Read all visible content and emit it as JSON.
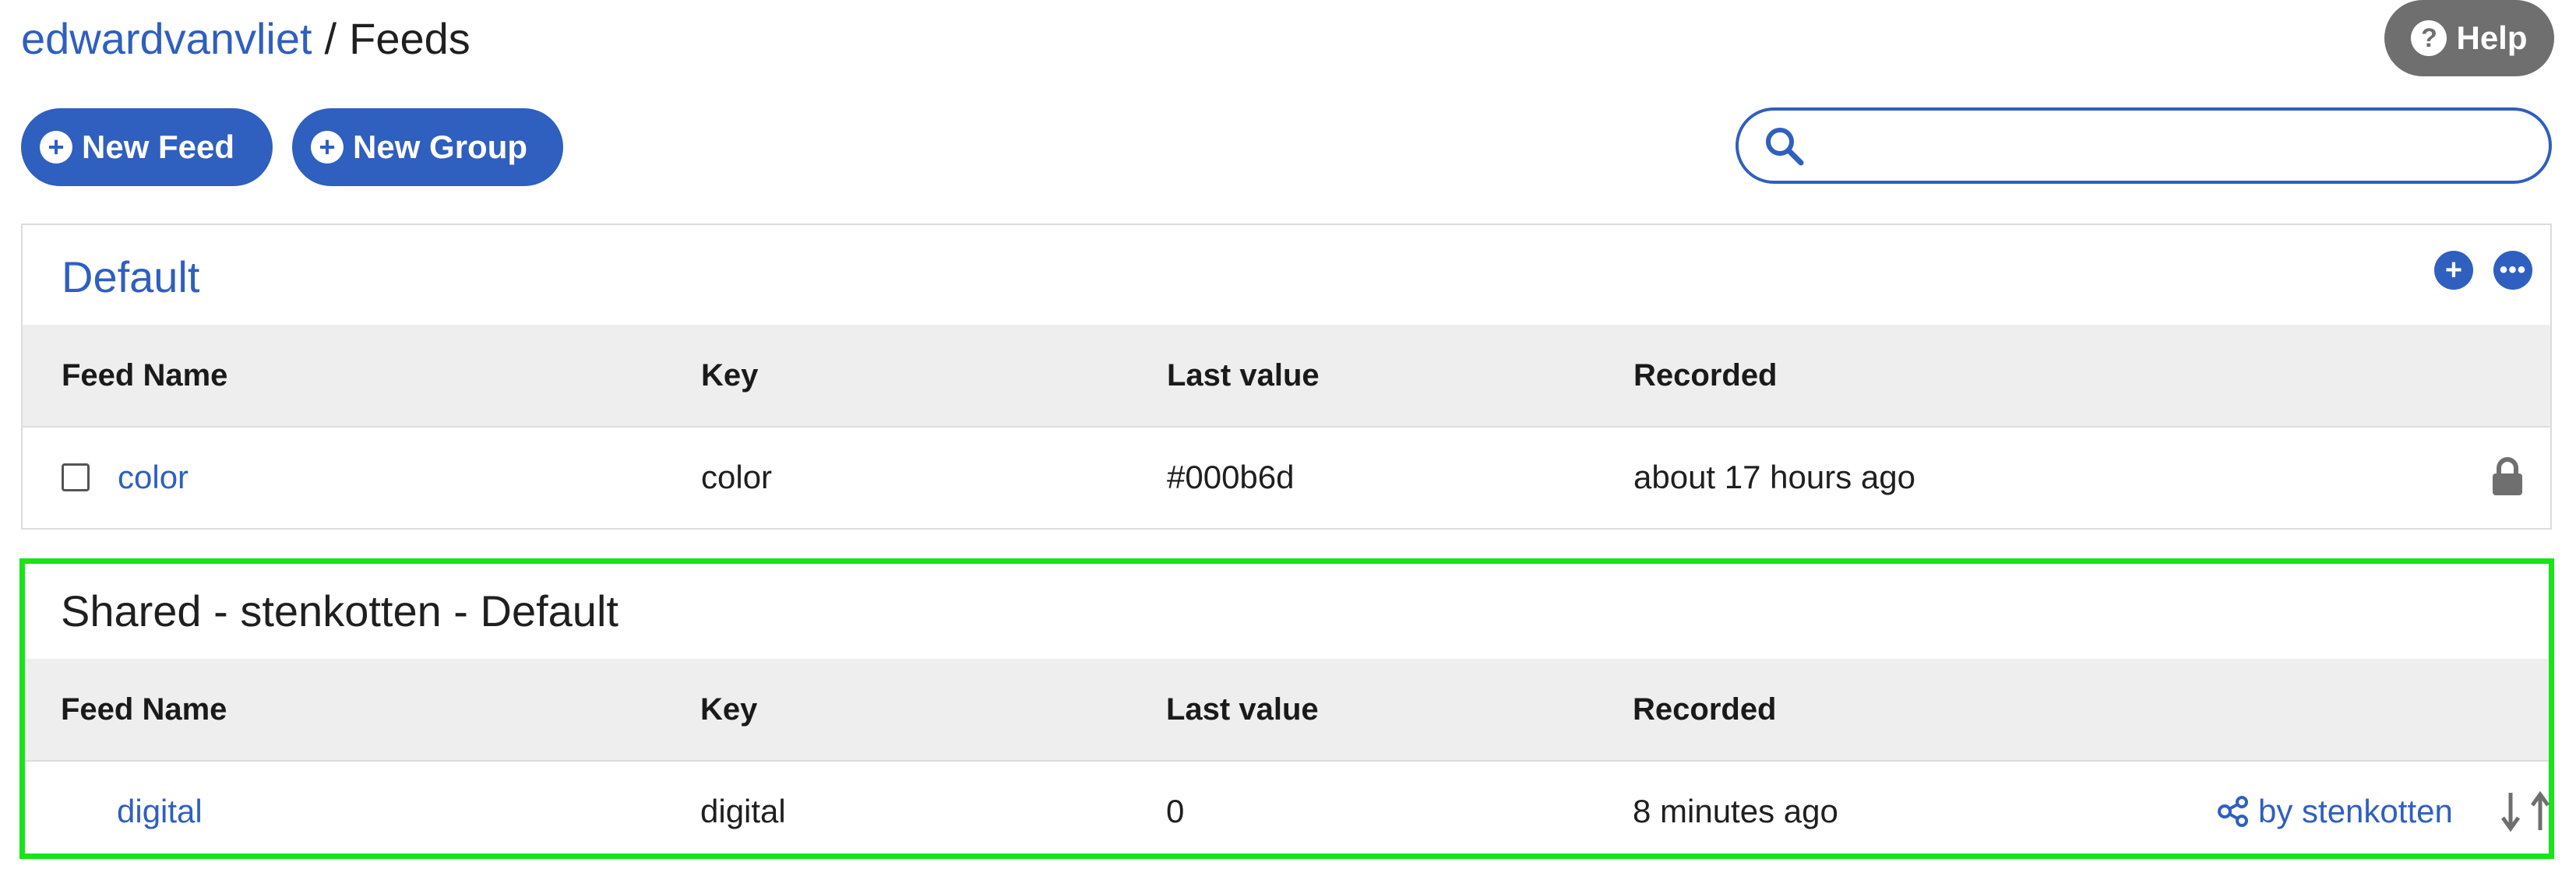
{
  "breadcrumb": {
    "user": "edwardvanvliet",
    "separator": "/",
    "current": "Feeds"
  },
  "help": {
    "label": "Help",
    "icon": "question-circle-icon"
  },
  "toolbar": {
    "new_feed_label": "New Feed",
    "new_group_label": "New Group"
  },
  "search": {
    "value": "",
    "placeholder": ""
  },
  "colors": {
    "accent": "#2f5fbf",
    "help_bg": "#6f6f6f",
    "table_head_bg": "#eeeeee",
    "highlight_border": "#18e418"
  },
  "groups": [
    {
      "title": "Default",
      "columns": [
        "Feed Name",
        "Key",
        "Last value",
        "Recorded"
      ],
      "rows": [
        {
          "name": "color",
          "key": "color",
          "last_value": "#000b6d",
          "recorded": "about 17 hours ago",
          "status_icon": "lock-icon"
        }
      ]
    },
    {
      "title": "Shared - stenkotten - Default",
      "columns": [
        "Feed Name",
        "Key",
        "Last value",
        "Recorded"
      ],
      "rows": [
        {
          "name": "digital",
          "key": "digital",
          "last_value": "0",
          "recorded": "8 minutes ago",
          "shared_by": "by stenkotten"
        }
      ]
    }
  ]
}
